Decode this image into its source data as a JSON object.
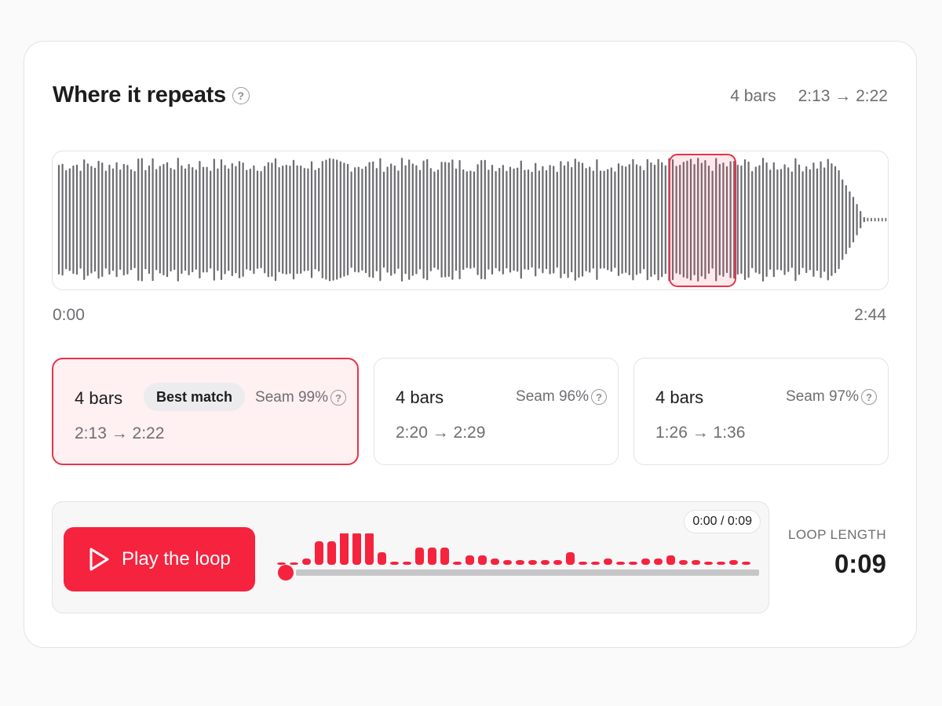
{
  "header": {
    "title": "Where it repeats",
    "help_icon": "question-circle-icon",
    "bars": "4 bars",
    "range": "2:13 → 2:22"
  },
  "waveform": {
    "start_time": "0:00",
    "end_time": "2:44",
    "selection": {
      "start_time": "2:13",
      "end_time": "2:22"
    }
  },
  "matches": [
    {
      "bars": "4 bars",
      "badge": "Best match",
      "seam": "Seam 99%",
      "range": "2:13 → 2:22",
      "selected": true
    },
    {
      "bars": "4 bars",
      "seam": "Seam 96%",
      "range": "2:20 → 2:29",
      "selected": false
    },
    {
      "bars": "4 bars",
      "seam": "Seam 97%",
      "range": "1:26 → 1:36",
      "selected": false
    }
  ],
  "player": {
    "play_label": "Play the loop",
    "play_icon": "play-outline-icon",
    "time_display": "0:00 / 0:09",
    "progress": 0.0,
    "loop_length_label": "LOOP LENGTH",
    "loop_length_value": "0:09"
  },
  "colors": {
    "accent": "#f5233e",
    "selection_border": "#e8324a",
    "waveform": "#6b6b70",
    "muted_text": "#6e6e73",
    "track": "#c6c6c8"
  }
}
